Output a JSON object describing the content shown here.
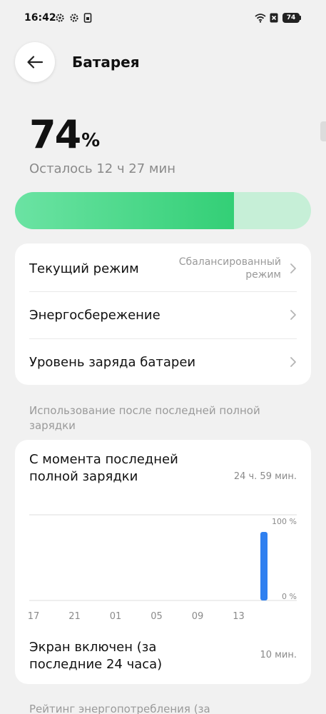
{
  "status_bar": {
    "time": "16:42",
    "battery_level": "74",
    "icons": [
      "settings-gear-icon",
      "settings-gear-icon",
      "sim-card-icon",
      "wifi-icon",
      "no-sim-icon",
      "battery-icon"
    ]
  },
  "header": {
    "title": "Батарея",
    "back_icon": "arrow-left-icon"
  },
  "battery": {
    "percent": "74",
    "unit": "%",
    "remaining": "Осталось 12 ч 27 мин",
    "fill_fraction": 0.74,
    "fill_color": "#33cf76",
    "track_color": "#c6efd7"
  },
  "settings": [
    {
      "label": "Текущий режим",
      "value": "Сбалансированный режим"
    },
    {
      "label": "Энергосбережение",
      "value": ""
    },
    {
      "label": "Уровень заряда батареи",
      "value": ""
    }
  ],
  "usage": {
    "section_header": "Использование после последней полной зарядки",
    "since_label": "С момента последней полной зарядки",
    "since_value": "24 ч. 59 мин.",
    "screen_on_label": "Экран включен (за последние 24 часа)",
    "screen_on_value": "10 мин."
  },
  "next_section_header": "Рейтинг энергопотребления (за",
  "chart_data": {
    "type": "bar",
    "x_ticks": [
      "17",
      "21",
      "01",
      "05",
      "09",
      "13"
    ],
    "y_tick_labels": [
      "100 %",
      "0 %"
    ],
    "ylim": [
      0,
      100
    ],
    "bars": [
      {
        "position": "after 13",
        "value": 80
      }
    ],
    "bar_color": "#2f80f0"
  }
}
